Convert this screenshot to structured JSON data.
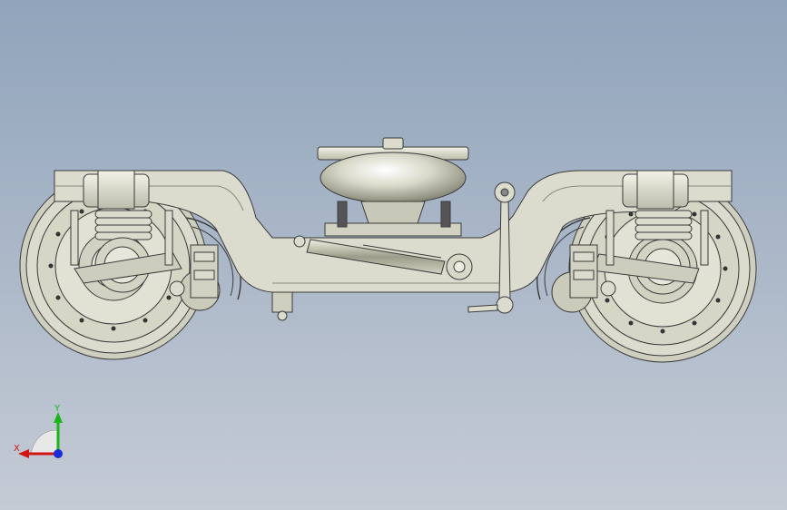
{
  "viewport": {
    "background_top": "#90a4bb",
    "background_bottom": "#c5cbd5"
  },
  "model": {
    "body_color": "#dcdcce",
    "shadow_color": "#b9b9a8",
    "line_color": "#3a3a3a",
    "air_spring_color": "#d6d6c6"
  },
  "triad": {
    "x_label": "X",
    "y_label": "Y",
    "x_color": "#d11414",
    "y_color": "#18b618",
    "z_color": "#1a2ed8"
  }
}
